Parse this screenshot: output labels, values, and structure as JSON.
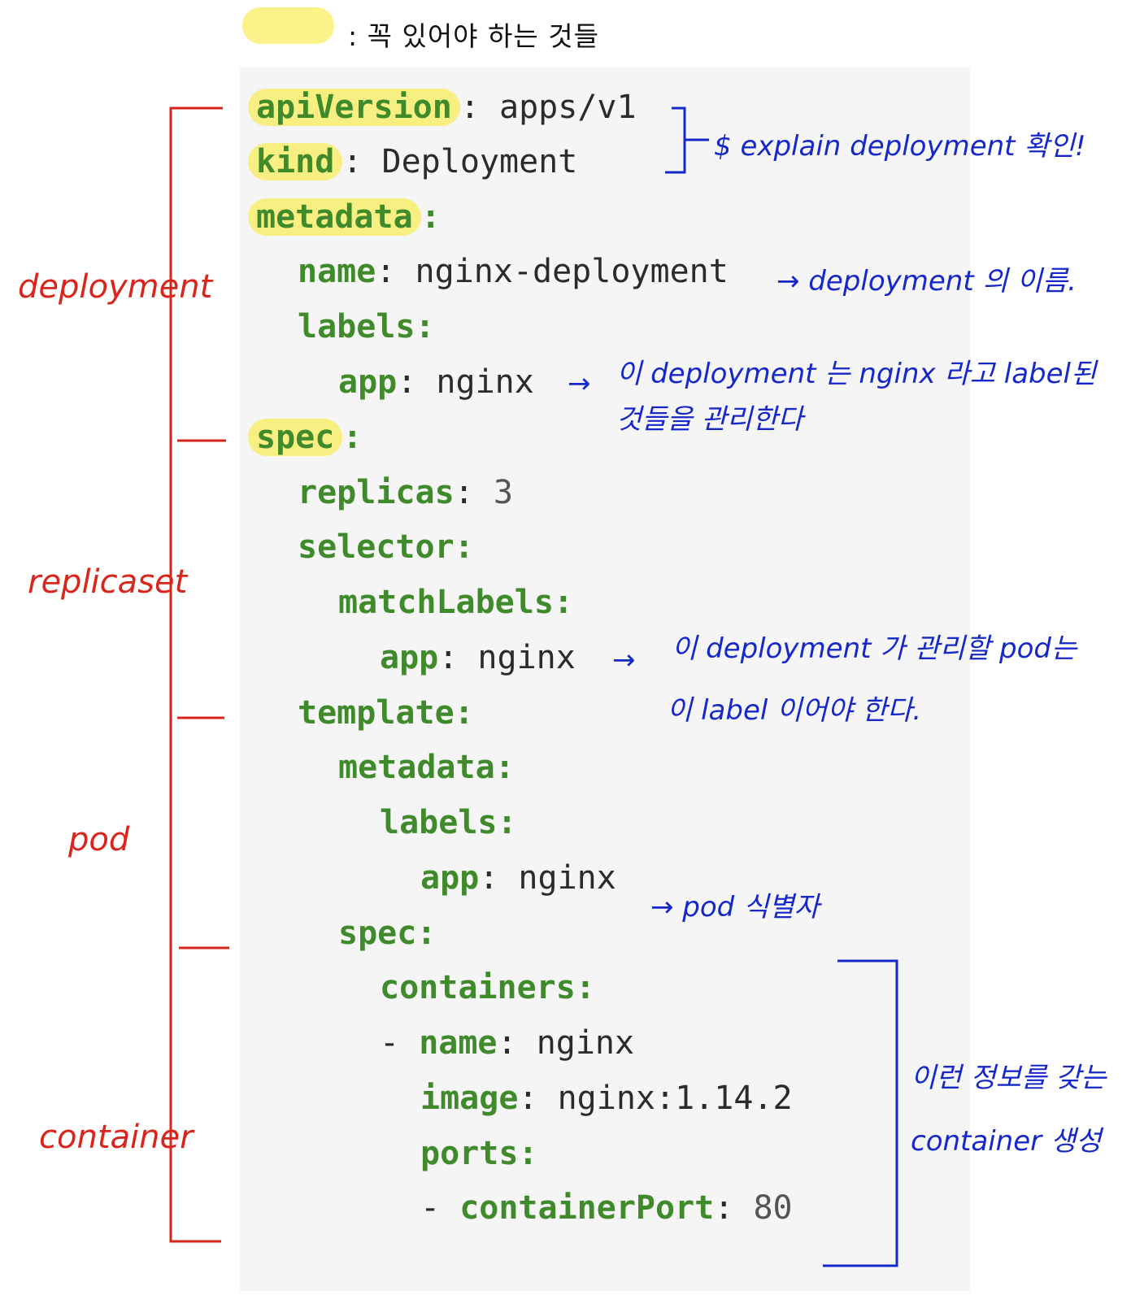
{
  "legend": {
    "swatch_color": "#fbf38a",
    "text": ": 꼭 있어야 하는 것들"
  },
  "code": {
    "apiVersion_key": "apiVersion",
    "apiVersion_value": "apps/v1",
    "kind_key": "kind",
    "kind_value": "Deployment",
    "metadata_key": "metadata",
    "name_key": "name",
    "name_value": "nginx-deployment",
    "labels_key": "labels",
    "app_key": "app",
    "app_value": "nginx",
    "spec_key": "spec",
    "replicas_key": "replicas",
    "replicas_value": "3",
    "selector_key": "selector",
    "matchLabels_key": "matchLabels",
    "template_key": "template",
    "containers_key": "containers",
    "dash": "-",
    "container_name_value": "nginx",
    "image_key": "image",
    "image_value": "nginx:1.14.2",
    "ports_key": "ports",
    "containerPort_key": "containerPort",
    "containerPort_value": "80"
  },
  "notes": {
    "explain": "$ explain deployment 확인!",
    "deployment_name": "→ deployment 의 이름.",
    "labels_line1": "이 deployment 는  nginx 라고 label된",
    "labels_line2": "것들을 관리한다",
    "selector_line1": "이 deployment 가 관리할 pod는",
    "selector_line2": "이 label 이어야 한다.",
    "pod_id": "→ pod 식별자",
    "container_line1": "이런 정보를 갖는",
    "container_line2": "container 생성",
    "arrow": "→"
  },
  "sections": {
    "deployment": "deployment",
    "replicaset": "replicaset",
    "pod": "pod",
    "container": "container"
  },
  "colors": {
    "annotation_blue": "#1628c8",
    "section_red": "#d9261c",
    "yaml_key_green": "#3f8a2a",
    "highlight_yellow": "#f7ef82"
  }
}
